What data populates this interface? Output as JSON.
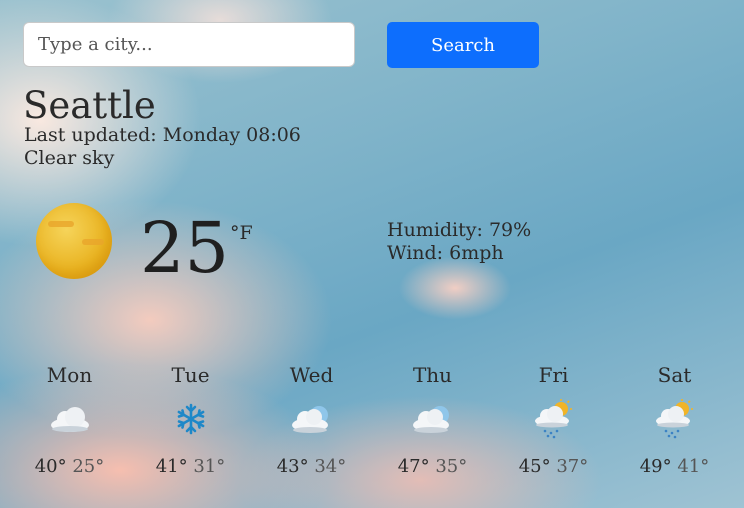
{
  "search": {
    "placeholder": "Type a city...",
    "button_label": "Search"
  },
  "current": {
    "city": "Seattle",
    "last_updated": "Last updated: Monday 08:06",
    "description": "Clear sky",
    "icon": "sun-icon",
    "temperature": "25",
    "unit": "°F",
    "humidity": "Humidity: 79%",
    "wind": "Wind: 6mph"
  },
  "forecast": [
    {
      "day": "Mon",
      "icon": "cloud-icon",
      "high": "40°",
      "low": "25°"
    },
    {
      "day": "Tue",
      "icon": "snowflake-icon",
      "high": "41°",
      "low": "31°"
    },
    {
      "day": "Wed",
      "icon": "cloud-icon",
      "high": "43°",
      "low": "34°"
    },
    {
      "day": "Thu",
      "icon": "cloud-icon",
      "high": "47°",
      "low": "35°"
    },
    {
      "day": "Fri",
      "icon": "sun-cloud-rain-icon",
      "high": "45°",
      "low": "37°"
    },
    {
      "day": "Sat",
      "icon": "sun-cloud-rain-icon",
      "high": "49°",
      "low": "41°"
    }
  ],
  "colors": {
    "accent": "#0d6efd",
    "sun": "#e9b321",
    "snow": "#1e88c8"
  }
}
